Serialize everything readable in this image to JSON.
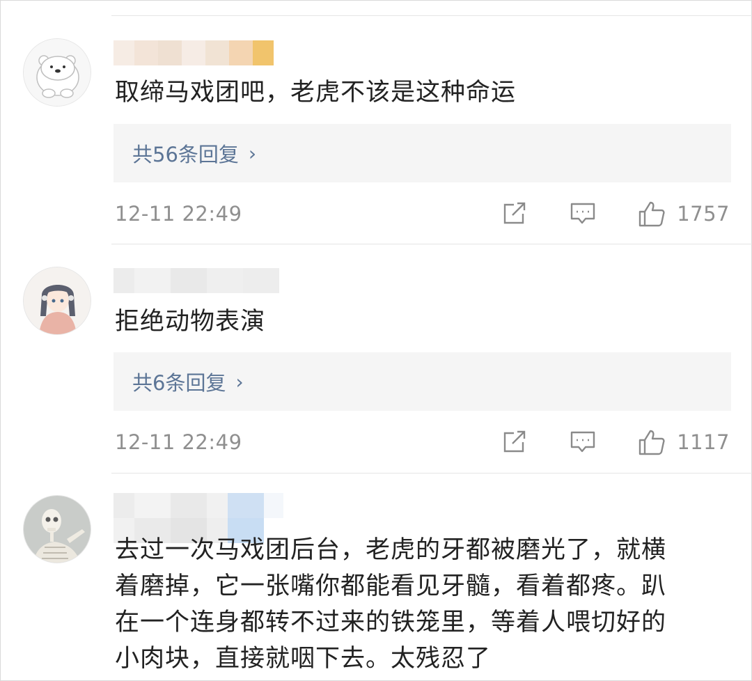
{
  "comments": [
    {
      "text": "取缔马戏团吧，老虎不该是这种命运",
      "replies_label": "共56条回复",
      "timestamp": "12-11 22:49",
      "likes": "1757",
      "avatar_icon": "polar-bear-avatar"
    },
    {
      "text": "拒绝动物表演",
      "replies_label": "共6条回复",
      "timestamp": "12-11 22:49",
      "likes": "1117",
      "avatar_icon": "anime-girl-avatar"
    },
    {
      "text_lines": [
        "去过一次马戏团后台，老虎的牙都被磨光了，就横",
        "着磨掉，它一张嘴你都能看见牙髓，看着都疼。趴",
        "在一个连身都转不过来的铁笼里，等着人喂切好的",
        "小肉块，直接就咽下去。太残忍了"
      ],
      "avatar_icon": "skeleton-avatar"
    }
  ],
  "icons": {
    "share": "share-icon",
    "comment": "comment-icon",
    "like": "thumbs-up-icon",
    "chevron": "chevron-right-icon"
  },
  "colors": {
    "link": "#5c7596",
    "meta": "#8f8f8f",
    "reply_bg": "#f5f5f5",
    "divider": "#e5e5e5"
  }
}
